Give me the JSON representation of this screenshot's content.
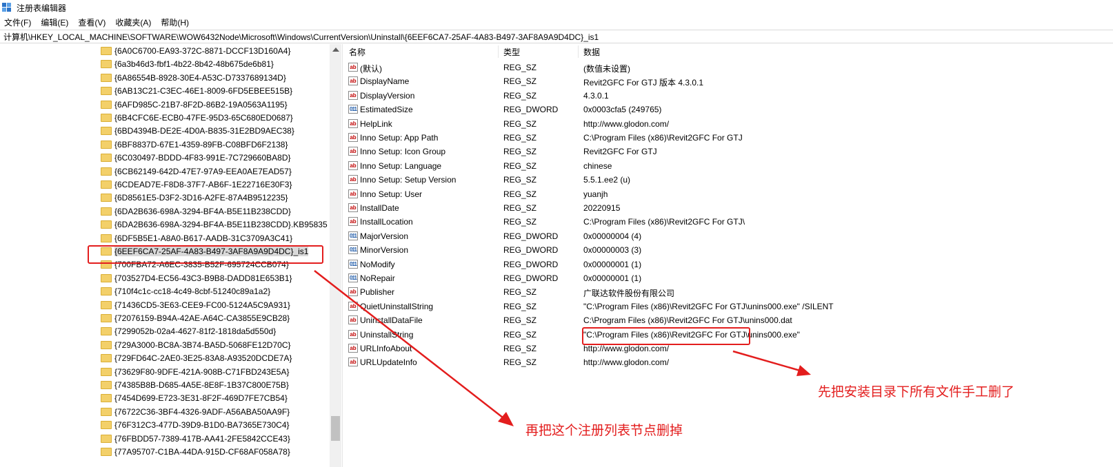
{
  "window": {
    "title": "注册表编辑器"
  },
  "menu": [
    "文件(F)",
    "编辑(E)",
    "查看(V)",
    "收藏夹(A)",
    "帮助(H)"
  ],
  "address": "计算机\\HKEY_LOCAL_MACHINE\\SOFTWARE\\WOW6432Node\\Microsoft\\Windows\\CurrentVersion\\Uninstall\\{6EEF6CA7-25AF-4A83-B497-3AF8A9A9D4DC}_is1",
  "tree": {
    "items": [
      "{6A0C6700-EA93-372C-8871-DCCF13D160A4}",
      "{6a3b46d3-fbf1-4b22-8b42-48b675de6b81}",
      "{6A86554B-8928-30E4-A53C-D7337689134D}",
      "{6AB13C21-C3EC-46E1-8009-6FD5EBEE515B}",
      "{6AFD985C-21B7-8F2D-86B2-19A0563A1195}",
      "{6B4CFC6E-ECB0-47FE-95D3-65C680ED0687}",
      "{6BD4394B-DE2E-4D0A-B835-31E2BD9AEC38}",
      "{6BF8837D-67E1-4359-89FB-C08BFD6F2138}",
      "{6C030497-BDDD-4F83-991E-7C729660BA8D}",
      "{6CB62149-642D-47E7-97A9-EEA0AE7EAD57}",
      "{6CDEAD7E-F8D8-37F7-AB6F-1E22716E30F3}",
      "{6D8561E5-D3F2-3D16-A2FE-87A4B9512235}",
      "{6DA2B636-698A-3294-BF4A-B5E11B238CDD}",
      "{6DA2B636-698A-3294-BF4A-B5E11B238CDD}.KB95835",
      "{6DF5B5E1-A8A0-B617-AADB-31C3709A3C41}",
      "{6EEF6CA7-25AF-4A83-B497-3AF8A9A9D4DC}_is1",
      "{700FBA72-A6EC-3835-B52F-695724CCB074}",
      "{703527D4-EC56-43C3-B9B8-DADD81E653B1}",
      "{710f4c1c-cc18-4c49-8cbf-51240c89a1a2}",
      "{71436CD5-3E63-CEE9-FC00-5124A5C9A931}",
      "{72076159-B94A-42AE-A64C-CA3855E9CB28}",
      "{7299052b-02a4-4627-81f2-1818da5d550d}",
      "{729A3000-BC8A-3B74-BA5D-5068FE12D70C}",
      "{729FD64C-2AE0-3E25-83A8-A93520DCDE7A}",
      "{73629F80-9DFE-421A-908B-C71FBD243E5A}",
      "{74385B8B-D685-4A5E-8E8F-1B37C800E75B}",
      "{7454D699-E723-3E31-8F2F-469D7FE7CB54}",
      "{76722C36-3BF4-4326-9ADF-A56ABA50AA9F}",
      "{76F312C3-477D-39D9-B1D0-BA7365E730C4}",
      "{76FBDD57-7389-417B-AA41-2FE5842CCE43}",
      "{77A95707-C1BA-44DA-915D-CF68AF058A78}"
    ]
  },
  "columns": {
    "name": "名称",
    "type": "类型",
    "data": "数据"
  },
  "values": [
    {
      "name": "(默认)",
      "type": "REG_SZ",
      "data": "(数值未设置)",
      "kind": "sz"
    },
    {
      "name": "DisplayName",
      "type": "REG_SZ",
      "data": "Revit2GFC For GTJ 版本 4.3.0.1",
      "kind": "sz"
    },
    {
      "name": "DisplayVersion",
      "type": "REG_SZ",
      "data": "4.3.0.1",
      "kind": "sz"
    },
    {
      "name": "EstimatedSize",
      "type": "REG_DWORD",
      "data": "0x0003cfa5 (249765)",
      "kind": "dw"
    },
    {
      "name": "HelpLink",
      "type": "REG_SZ",
      "data": "http://www.glodon.com/",
      "kind": "sz"
    },
    {
      "name": "Inno Setup: App Path",
      "type": "REG_SZ",
      "data": "C:\\Program Files (x86)\\Revit2GFC For GTJ",
      "kind": "sz"
    },
    {
      "name": "Inno Setup: Icon Group",
      "type": "REG_SZ",
      "data": "Revit2GFC For GTJ",
      "kind": "sz"
    },
    {
      "name": "Inno Setup: Language",
      "type": "REG_SZ",
      "data": "chinese",
      "kind": "sz"
    },
    {
      "name": "Inno Setup: Setup Version",
      "type": "REG_SZ",
      "data": "5.5.1.ee2 (u)",
      "kind": "sz"
    },
    {
      "name": "Inno Setup: User",
      "type": "REG_SZ",
      "data": "yuanjh",
      "kind": "sz"
    },
    {
      "name": "InstallDate",
      "type": "REG_SZ",
      "data": "20220915",
      "kind": "sz"
    },
    {
      "name": "InstallLocation",
      "type": "REG_SZ",
      "data": "C:\\Program Files (x86)\\Revit2GFC For GTJ\\",
      "kind": "sz"
    },
    {
      "name": "MajorVersion",
      "type": "REG_DWORD",
      "data": "0x00000004 (4)",
      "kind": "dw"
    },
    {
      "name": "MinorVersion",
      "type": "REG_DWORD",
      "data": "0x00000003 (3)",
      "kind": "dw"
    },
    {
      "name": "NoModify",
      "type": "REG_DWORD",
      "data": "0x00000001 (1)",
      "kind": "dw"
    },
    {
      "name": "NoRepair",
      "type": "REG_DWORD",
      "data": "0x00000001 (1)",
      "kind": "dw"
    },
    {
      "name": "Publisher",
      "type": "REG_SZ",
      "data": "广联达软件股份有限公司",
      "kind": "sz"
    },
    {
      "name": "QuietUninstallString",
      "type": "REG_SZ",
      "data": "\"C:\\Program Files (x86)\\Revit2GFC For GTJ\\unins000.exe\" /SILENT",
      "kind": "sz"
    },
    {
      "name": "UninstallDataFile",
      "type": "REG_SZ",
      "data": "C:\\Program Files (x86)\\Revit2GFC For GTJ\\unins000.dat",
      "kind": "sz"
    },
    {
      "name": "UninstallString",
      "type": "REG_SZ",
      "data": "\"C:\\Program Files (x86)\\Revit2GFC For GTJ\\unins000.exe\"",
      "kind": "sz"
    },
    {
      "name": "URLInfoAbout",
      "type": "REG_SZ",
      "data": "http://www.glodon.com/",
      "kind": "sz"
    },
    {
      "name": "URLUpdateInfo",
      "type": "REG_SZ",
      "data": "http://www.glodon.com/",
      "kind": "sz"
    }
  ],
  "annotations": {
    "note1": "再把这个注册列表节点删掉",
    "note2": "先把安装目录下所有文件手工删了",
    "color": "#e31d1d"
  },
  "icons": {
    "string_value": "ab",
    "dword_value": "011"
  }
}
